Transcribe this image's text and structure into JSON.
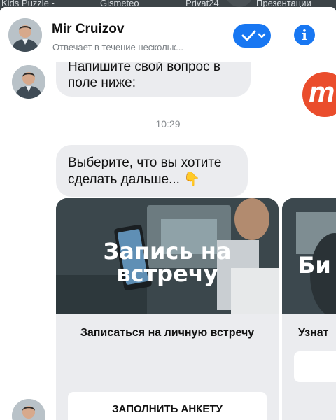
{
  "background_tabs": [
    "Kids Puzzle -",
    "Gismeteo",
    "Privat24",
    "Презентации"
  ],
  "contact": {
    "name": "Mir Cruizov",
    "status": "Отвечает в течение нескольк...",
    "avatar_icon": "person-avatar"
  },
  "header_actions": {
    "check_icon": "check-chevron-icon",
    "info_label": "i"
  },
  "messages": [
    {
      "lines": [
        "Напишите свой вопрос в",
        "поле ниже:"
      ]
    },
    {
      "lines": [
        "Выберите, что вы хотите",
        "сделать дальше... 👇"
      ]
    }
  ],
  "logo_letter": "m",
  "timestamp": "10:29",
  "cards": [
    {
      "image_text_lines": [
        "Запись на",
        "встречу"
      ],
      "title": "Записаться на личную встречу",
      "button": "ЗАПОЛНИТЬ АНКЕТУ"
    },
    {
      "image_text_lines": [
        "Би"
      ],
      "title": "Узнат"
    }
  ],
  "colors": {
    "accent": "#1877f2",
    "bubble": "#ebecef",
    "logo": "#ea4d2c"
  }
}
